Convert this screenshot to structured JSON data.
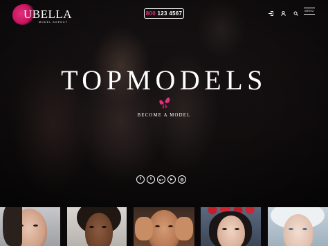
{
  "header": {
    "logo_name": "UBELLA",
    "logo_tagline": "MODEL AGENCY",
    "phone_prefix": "800",
    "phone_number": "123 4567",
    "menu_label": "MENU"
  },
  "hero": {
    "title": "TOPMODELS",
    "cta_label": "BECOME A MODEL"
  },
  "social": [
    {
      "name": "facebook-icon",
      "glyph": "f"
    },
    {
      "name": "twitter-icon",
      "glyph": "t"
    },
    {
      "name": "google-plus-icon",
      "glyph": "G+"
    },
    {
      "name": "youtube-icon",
      "glyph": "▶"
    },
    {
      "name": "instagram-icon",
      "glyph": "◎"
    }
  ],
  "colors": {
    "accent": "#e0317c",
    "background": "#0a0809",
    "text": "#ffffff"
  }
}
